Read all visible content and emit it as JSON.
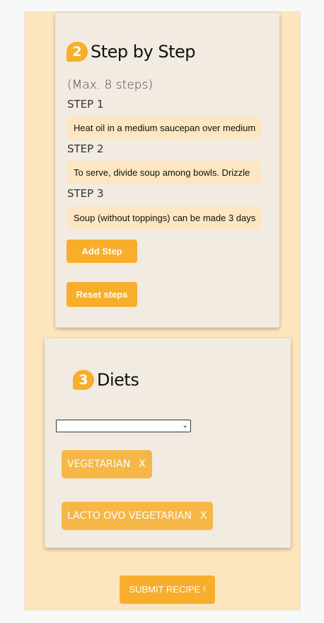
{
  "steps_section": {
    "number": "2",
    "title": "Step by Step",
    "max_text": "(Max. 8 steps)",
    "steps": [
      {
        "label": "STEP 1",
        "value": "Heat oil in a medium saucepan over medium"
      },
      {
        "label": "STEP 2",
        "value": "To serve, divide soup among bowls. Drizzle"
      },
      {
        "label": "STEP 3",
        "value": "Soup (without toppings) can be made 3 days"
      }
    ],
    "add_step_label": "Add Step",
    "reset_steps_label": "Reset steps"
  },
  "diets_section": {
    "number": "3",
    "title": "Diets",
    "select_value": "",
    "tags": [
      {
        "label": "VEGETARIAN",
        "remove": "X"
      },
      {
        "label": "LACTO OVO VEGETARIAN",
        "remove": "X"
      }
    ]
  },
  "submit_label": "SUBMIT RECIPE !",
  "colors": {
    "accent": "#f9ae2b",
    "tag": "#f6b746",
    "card": "#f1ebe1",
    "input_bg": "#fde7c3",
    "page_bg": "#fde6bd"
  },
  "icons": {
    "select_caret": "chevron-down-icon"
  }
}
